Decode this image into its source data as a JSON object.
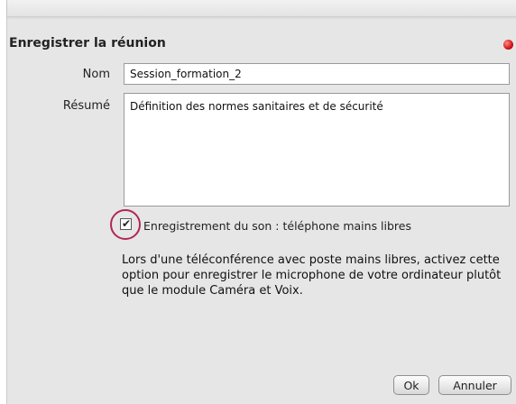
{
  "dialog": {
    "title": "Enregistrer la réunion",
    "close_icon": "close-icon",
    "close_color": "#d01414"
  },
  "form": {
    "name_label": "Nom",
    "name_value": "Session_formation_2",
    "summary_label": "Résumé",
    "summary_value": "Définition des normes sanitaires et de sécurité",
    "audio_checkbox": {
      "label": "Enregistrement du son : téléphone mains libres",
      "checked": true
    },
    "help_text": "Lors d'une téléconférence avec poste mains libres, activez cette option pour enregistrer le microphone de votre ordinateur plutôt que le module Caméra et Voix."
  },
  "buttons": {
    "ok_label": "Ok",
    "cancel_label": "Annuler"
  },
  "colors": {
    "highlight_ring": "#b0285a",
    "dialog_bg": "#e6e6e6"
  }
}
